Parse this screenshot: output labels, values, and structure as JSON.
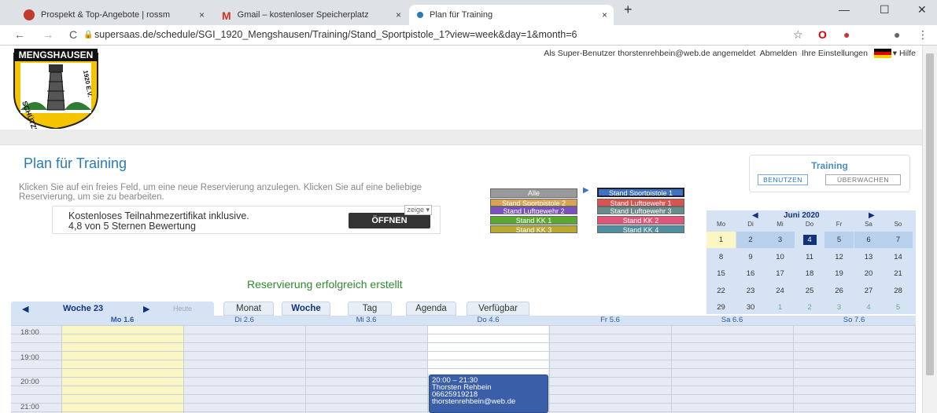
{
  "browser": {
    "tabs": [
      {
        "title": "Prospekt & Top-Angebote | rossm",
        "close": "×",
        "favicon_color": "#c0392b"
      },
      {
        "title": "Gmail – kostenloser Speicherplatz",
        "close": "×",
        "favicon_color": "#d93025"
      },
      {
        "title": "Plan für Training",
        "close": "×",
        "favicon_color": "#2a7ab8"
      }
    ],
    "new_tab": "+",
    "window_controls": [
      "—",
      "☐",
      "✕"
    ],
    "url": "supersaas.de/schedule/SGI_1920_Mengshausen/Training/Stand_Sportpistole_1?view=week&day=1&month=6"
  },
  "header": {
    "logo_top": "MENGSHAUSEN",
    "logo_left": "SCHÜTZENGILDE",
    "logo_year": "1920 E.V.",
    "user_text": "Als Super-Benutzer thorstenrehbein@web.de angemeldet",
    "logout": "Abmelden",
    "settings": "Ihre Einstellungen",
    "help": "Hilfe"
  },
  "main": {
    "title": "Plan für Training",
    "hint": "Klicken Sie auf ein freies Feld, um eine neue Reservierung anzulegen. Klicken Sie auf eine beliebige Reservierung, um sie zu bearbeiten.",
    "ad": {
      "line1": "Kostenloses Teilnahmezertifikat inklusive.",
      "line2": "4,8 von 5 Sternen Bewertung",
      "button": "ÖFFNEN",
      "tag": "zeige"
    },
    "resources_left": [
      {
        "label": "Alle",
        "color": "#9a9a9a"
      },
      {
        "label": "Stand Sportpistole 2",
        "color": "#d9a35a"
      },
      {
        "label": "Stand Luftgewehr 2",
        "color": "#7a4fc0"
      },
      {
        "label": "Stand KK 1",
        "color": "#5aa830"
      },
      {
        "label": "Stand KK 3",
        "color": "#b8a830"
      }
    ],
    "resources_right": [
      {
        "label": "Stand Sportpistole 1",
        "color": "#3f72c4"
      },
      {
        "label": "Stand Luftgewehr 1",
        "color": "#d9534f"
      },
      {
        "label": "Stand Luftgewehr 3",
        "color": "#6b8a8a"
      },
      {
        "label": "Stand KK 2",
        "color": "#e0567a"
      },
      {
        "label": "Stand KK 4",
        "color": "#4f8fa0"
      }
    ],
    "success": "Reservierung erfolgreich erstellt"
  },
  "training_box": {
    "title": "Training",
    "use": "BENUTZEN",
    "watch": "ÜBERWACHEN"
  },
  "calendar": {
    "prev": "◀",
    "next": "▶",
    "month": "Juni 2020",
    "days": [
      "Mo",
      "Di",
      "Mi",
      "Do",
      "Fr",
      "Sa",
      "So"
    ],
    "weeks": [
      [
        "1",
        "2",
        "3",
        "4",
        "5",
        "6",
        "7"
      ],
      [
        "8",
        "9",
        "10",
        "11",
        "12",
        "13",
        "14"
      ],
      [
        "15",
        "16",
        "17",
        "18",
        "19",
        "20",
        "21"
      ],
      [
        "22",
        "23",
        "24",
        "25",
        "26",
        "27",
        "28"
      ],
      [
        "29",
        "30",
        "1",
        "2",
        "3",
        "4",
        "5"
      ]
    ],
    "today": "1",
    "selected": "4"
  },
  "week_nav": {
    "prev": "◀",
    "label": "Woche 23",
    "next": "▶",
    "today": "Heute"
  },
  "view_tabs": [
    "Monat",
    "Woche",
    "Tag",
    "Agenda",
    "Verfügbar"
  ],
  "active_view": "Woche",
  "day_headers": [
    "Mo 1.6",
    "Di 2.6",
    "Mi 3.6",
    "Do 4.6",
    "Fr 5.6",
    "Sa 6.6",
    "So 7.6"
  ],
  "times": [
    "18:00",
    "19:00",
    "20:00",
    "21:00"
  ],
  "event": {
    "time": "20:00 – 21:30",
    "name": "Thorsten Rehbein",
    "phone": "06625919218",
    "email": "thorstenrehbein@web.de"
  }
}
